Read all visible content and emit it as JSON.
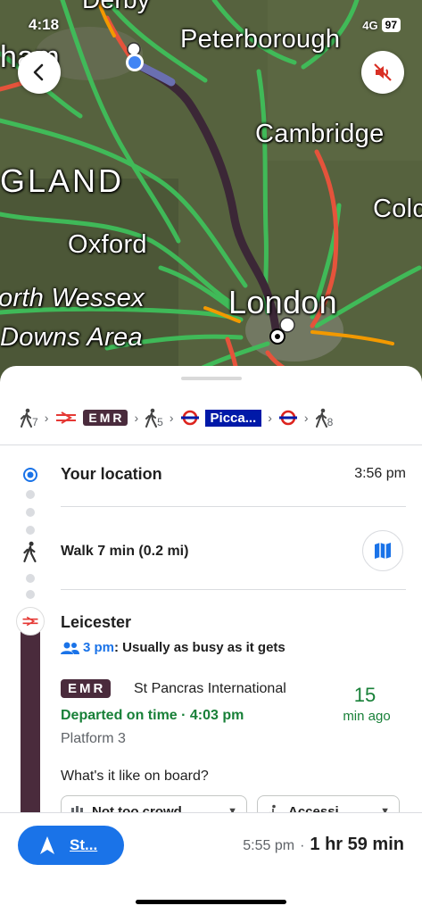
{
  "status": {
    "time": "4:18",
    "network": "4G",
    "battery": "97"
  },
  "map": {
    "labels": {
      "derby": "Derby",
      "ham": "ham",
      "peterborough": "Peterborough",
      "cambridge": "Cambridge",
      "england": "GLAND",
      "oxford": "Oxford",
      "colc": "Colc",
      "wessex": "orth Wessex",
      "downs": "Downs Area",
      "london": "London"
    },
    "icons": {
      "back": "back-arrow-icon",
      "mute": "sound-off-icon"
    }
  },
  "summary": {
    "walk1": "7",
    "emr": "EMR",
    "walk2": "5",
    "piccadilly": "Picca...",
    "walk3": "8"
  },
  "steps": {
    "origin": {
      "title": "Your location",
      "time": "3:56 pm"
    },
    "walk": {
      "title": "Walk 7 min (0.2 mi)"
    },
    "station": {
      "title": "Leicester",
      "busy_time": "3 pm",
      "busy_text": ": Usually as busy as it gets",
      "operator": "EMR",
      "destination": "St Pancras International",
      "status": "Departed on time · 4:03 pm",
      "platform": "Platform 3",
      "minutes": "15",
      "minutes_label": "min ago",
      "question": "What's it like on board?",
      "chip1": "Not too crowd",
      "chip2": "Accessi"
    }
  },
  "bottom": {
    "start_label": "St...",
    "arrival": "5:55 pm",
    "separator": "·",
    "duration": "1 hr 59 min"
  },
  "colors": {
    "accent": "#1a73e8",
    "emr": "#4a2b3c",
    "piccadilly": "#0019a8",
    "on_time": "#188038"
  }
}
